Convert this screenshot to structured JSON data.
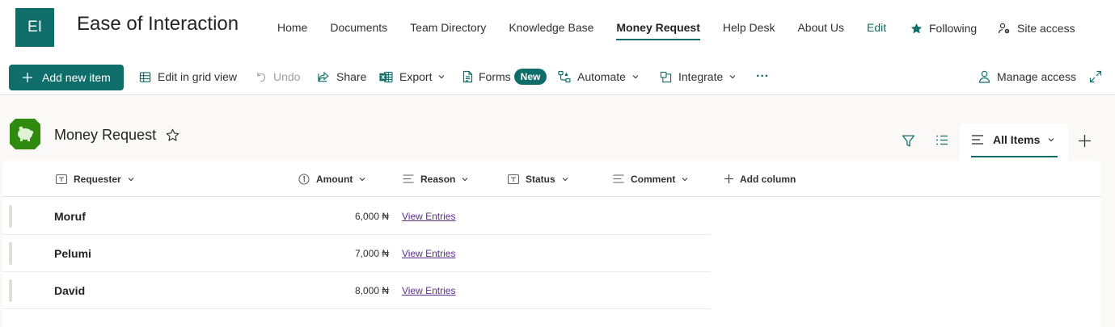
{
  "site": {
    "logo_initials": "EI",
    "title": "Ease of Interaction",
    "nav": [
      {
        "label": "Home"
      },
      {
        "label": "Documents"
      },
      {
        "label": "Team Directory"
      },
      {
        "label": "Knowledge Base"
      },
      {
        "label": "Money Request",
        "active": true
      },
      {
        "label": "Help Desk"
      },
      {
        "label": "About Us"
      },
      {
        "label": "Edit"
      }
    ],
    "following_label": "Following",
    "site_access_label": "Site access"
  },
  "command_bar": {
    "add_new_item": "Add new item",
    "edit_grid_view": "Edit in grid view",
    "undo": "Undo",
    "share": "Share",
    "export": "Export",
    "forms": "Forms",
    "forms_badge": "New",
    "automate": "Automate",
    "integrate": "Integrate",
    "more": "···",
    "manage_access": "Manage access"
  },
  "list": {
    "title": "Money Request",
    "view_name": "All Items"
  },
  "grid": {
    "columns": [
      {
        "label": "Requester",
        "icon": "text-field-icon"
      },
      {
        "label": "Amount",
        "icon": "number-field-icon"
      },
      {
        "label": "Reason",
        "icon": "multiline-field-icon"
      },
      {
        "label": "Status",
        "icon": "text-field-icon"
      },
      {
        "label": "Comment",
        "icon": "multiline-field-icon"
      }
    ],
    "add_column_label": "Add column",
    "rows": [
      {
        "requester": "Moruf",
        "amount": "6,000 ₦",
        "reason": "View Entries"
      },
      {
        "requester": "Pelumi",
        "amount": "7,000 ₦",
        "reason": "View Entries"
      },
      {
        "requester": "David",
        "amount": "8,000 ₦",
        "reason": "View Entries"
      }
    ]
  },
  "colors": {
    "accent": "#0f6e6a",
    "link": "#5c2d91",
    "list_icon": "#2e8b0e"
  }
}
